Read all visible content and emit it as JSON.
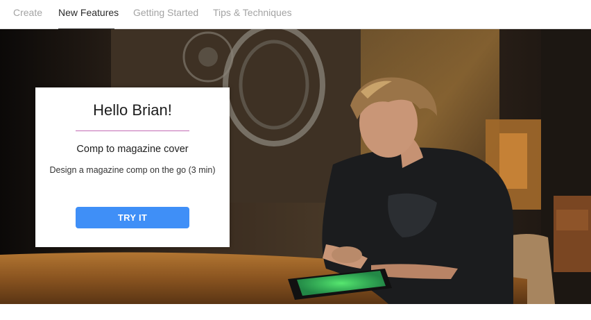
{
  "nav": {
    "tabs": [
      {
        "label": "Create",
        "active": false
      },
      {
        "label": "New Features",
        "active": true
      },
      {
        "label": "Getting Started",
        "active": false
      },
      {
        "label": "Tips & Techniques",
        "active": false
      }
    ]
  },
  "card": {
    "title": "Hello Brian!",
    "subtitle": "Comp to magazine cover",
    "description": "Design a magazine comp on the go (3 min)",
    "button_label": "TRY IT"
  },
  "colors": {
    "accent_button": "#3f8ff7",
    "divider": "#c36bb4",
    "active_tab": "#2a2a2a",
    "inactive_tab": "#a3a3a3"
  }
}
